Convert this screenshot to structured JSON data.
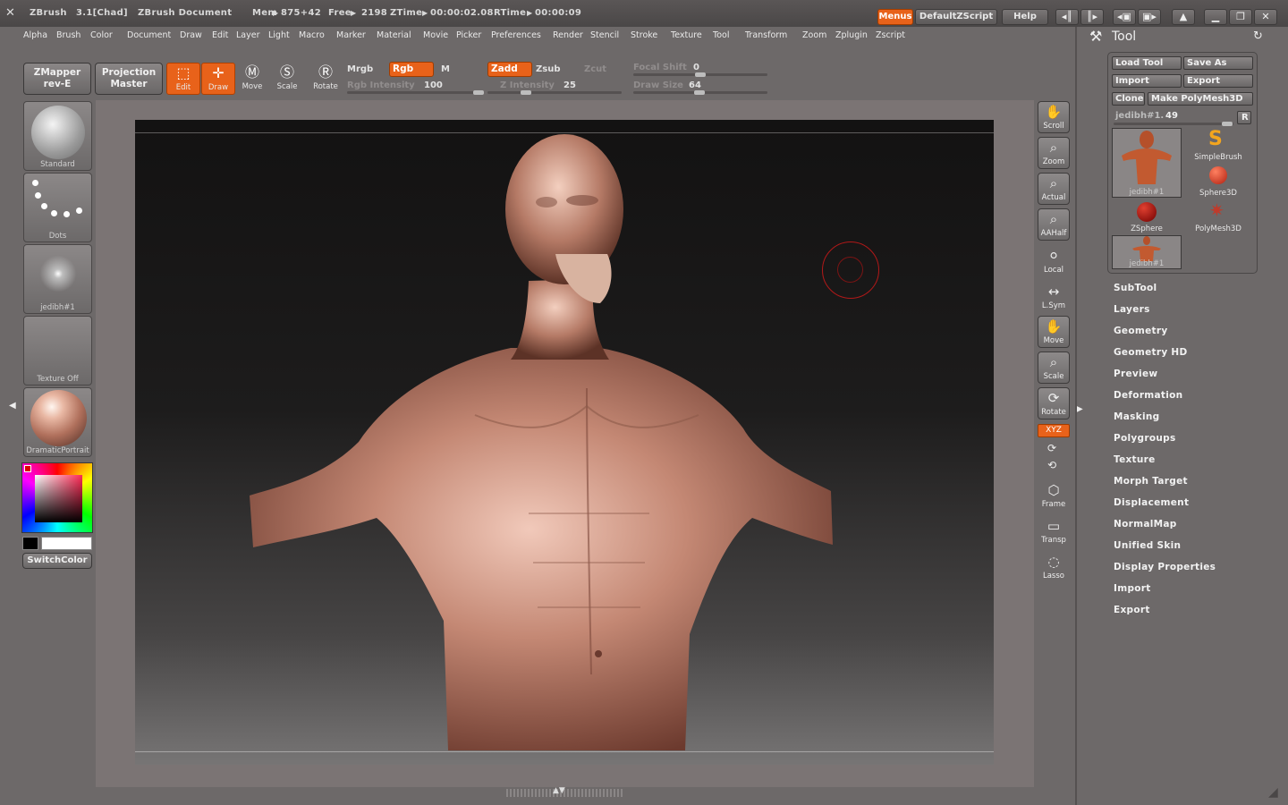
{
  "titlebar": {
    "app": "ZBrush",
    "version": "3.1[Chad]",
    "document": "ZBrush Document",
    "mem_label": "Mem",
    "mem_value": "875+42",
    "free_label": "Free",
    "free_value": "2198",
    "ztime_label": "ZTime",
    "ztime_value": "00:00:02.08",
    "rtime_label": "RTime",
    "rtime_value": "00:00:09",
    "menus_btn": "Menus",
    "script_btn": "DefaultZScript",
    "help_btn": "Help"
  },
  "menubar": [
    "Alpha",
    "Brush",
    "Color",
    "Document",
    "Draw",
    "Edit",
    "Layer",
    "Light",
    "Macro",
    "Marker",
    "Material",
    "Movie",
    "Picker",
    "Preferences",
    "Render",
    "Stencil",
    "Stroke",
    "Texture",
    "Tool",
    "Transform",
    "Zoom",
    "Zplugin",
    "Zscript"
  ],
  "shelf": {
    "zmapper_line1": "ZMapper",
    "zmapper_line2": "rev-E",
    "projection_line1": "Projection",
    "projection_line2": "Master",
    "edit": "Edit",
    "draw": "Draw",
    "move": "Move",
    "scale": "Scale",
    "rotate": "Rotate",
    "mrgb": "Mrgb",
    "rgb": "Rgb",
    "m": "M",
    "rgb_intensity_label": "Rgb Intensity",
    "rgb_intensity_value": "100",
    "zadd": "Zadd",
    "zsub": "Zsub",
    "zcut": "Zcut",
    "z_intensity_label": "Z Intensity",
    "z_intensity_value": "25",
    "focal_shift_label": "Focal Shift",
    "focal_shift_value": "0",
    "draw_size_label": "Draw Size",
    "draw_size_value": "64"
  },
  "left_palette": {
    "brush": "Standard",
    "stroke": "Dots",
    "alpha": "jedibh#1",
    "texture": "Texture Off",
    "material": "DramaticPortrait",
    "switch_color": "SwitchColor"
  },
  "right_toolbar": [
    "Scroll",
    "Zoom",
    "Actual",
    "AAHalf",
    "Local",
    "L.Sym",
    "Move",
    "Scale",
    "Rotate",
    "XYZ",
    "Frame",
    "Transp",
    "Lasso"
  ],
  "tool_panel": {
    "title": "Tool",
    "load_tool": "Load Tool",
    "save_as": "Save As",
    "import": "Import",
    "export": "Export",
    "clone": "Clone",
    "make_polymesh": "Make PolyMesh3D",
    "current_tool_label": "jedibh#1.",
    "current_tool_value": "49",
    "r_btn": "R",
    "thumbs": [
      "jedibh#1",
      "SimpleBrush",
      "Sphere3D",
      "ZSphere",
      "PolyMesh3D",
      "jedibh#1"
    ]
  },
  "subpalettes": [
    "SubTool",
    "Layers",
    "Geometry",
    "Geometry HD",
    "Preview",
    "Deformation",
    "Masking",
    "Polygroups",
    "Texture",
    "Morph Target",
    "Displacement",
    "NormalMap",
    "Unified Skin",
    "Display Properties",
    "Import",
    "Export"
  ],
  "colors": {
    "accent": "#e8621a",
    "ui_bg": "#6d6969",
    "skin": "#c48874"
  }
}
